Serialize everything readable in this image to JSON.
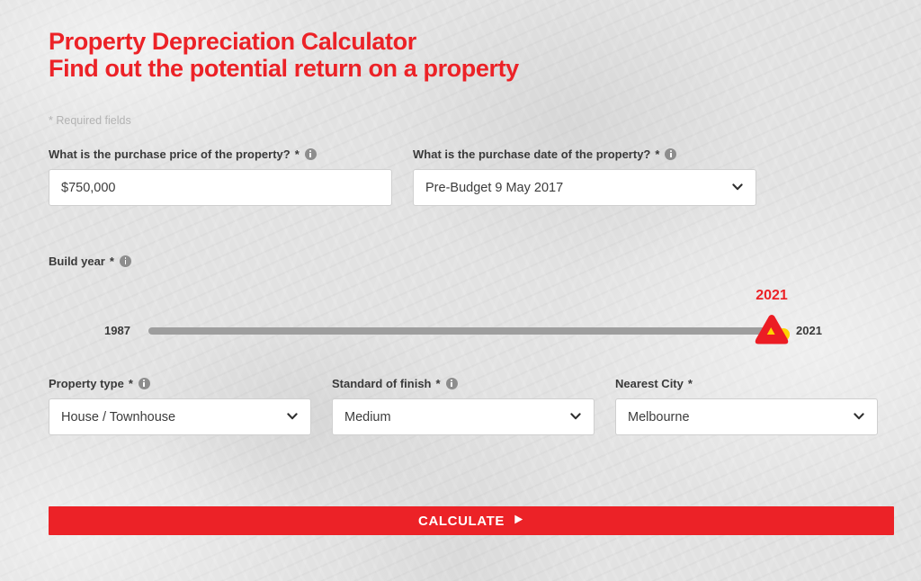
{
  "heading": {
    "line1": "Property Depreciation Calculator",
    "line2": "Find out the potential return on a property",
    "required_note": "* Required fields",
    "accent_color": "#ec2227"
  },
  "form": {
    "purchase_price": {
      "label": "What is the purchase price of the property?",
      "required_mark": "*",
      "info_icon": "info-icon",
      "value": "$750,000",
      "placeholder": "$750,000"
    },
    "purchase_date": {
      "label": "What is the purchase date of the property?",
      "required_mark": "*",
      "info_icon": "info-icon",
      "value": "Pre-Budget 9 May 2017",
      "chevron_icon": "chevron-down-icon"
    },
    "build_year": {
      "label": "Build year",
      "required_mark": "*",
      "info_icon": "info-icon",
      "min_label": "1987",
      "max_label": "2021",
      "value": "2021",
      "min": 1987,
      "max": 2021,
      "handle_icon": "triangle-slider-handle-icon"
    },
    "property_type": {
      "label": "Property type",
      "required_mark": "*",
      "info_icon": "info-icon",
      "value": "House / Townhouse",
      "chevron_icon": "chevron-down-icon"
    },
    "standard_of_finish": {
      "label": "Standard of finish",
      "required_mark": "*",
      "info_icon": "info-icon",
      "value": "Medium",
      "chevron_icon": "chevron-down-icon"
    },
    "nearest_city": {
      "label": "Nearest City",
      "required_mark": "*",
      "value": "Melbourne",
      "chevron_icon": "chevron-down-icon"
    }
  },
  "actions": {
    "calculate_label": "CALCULATE",
    "calculate_icon": "play-triangle-icon",
    "calculate_color": "#ec2227"
  }
}
